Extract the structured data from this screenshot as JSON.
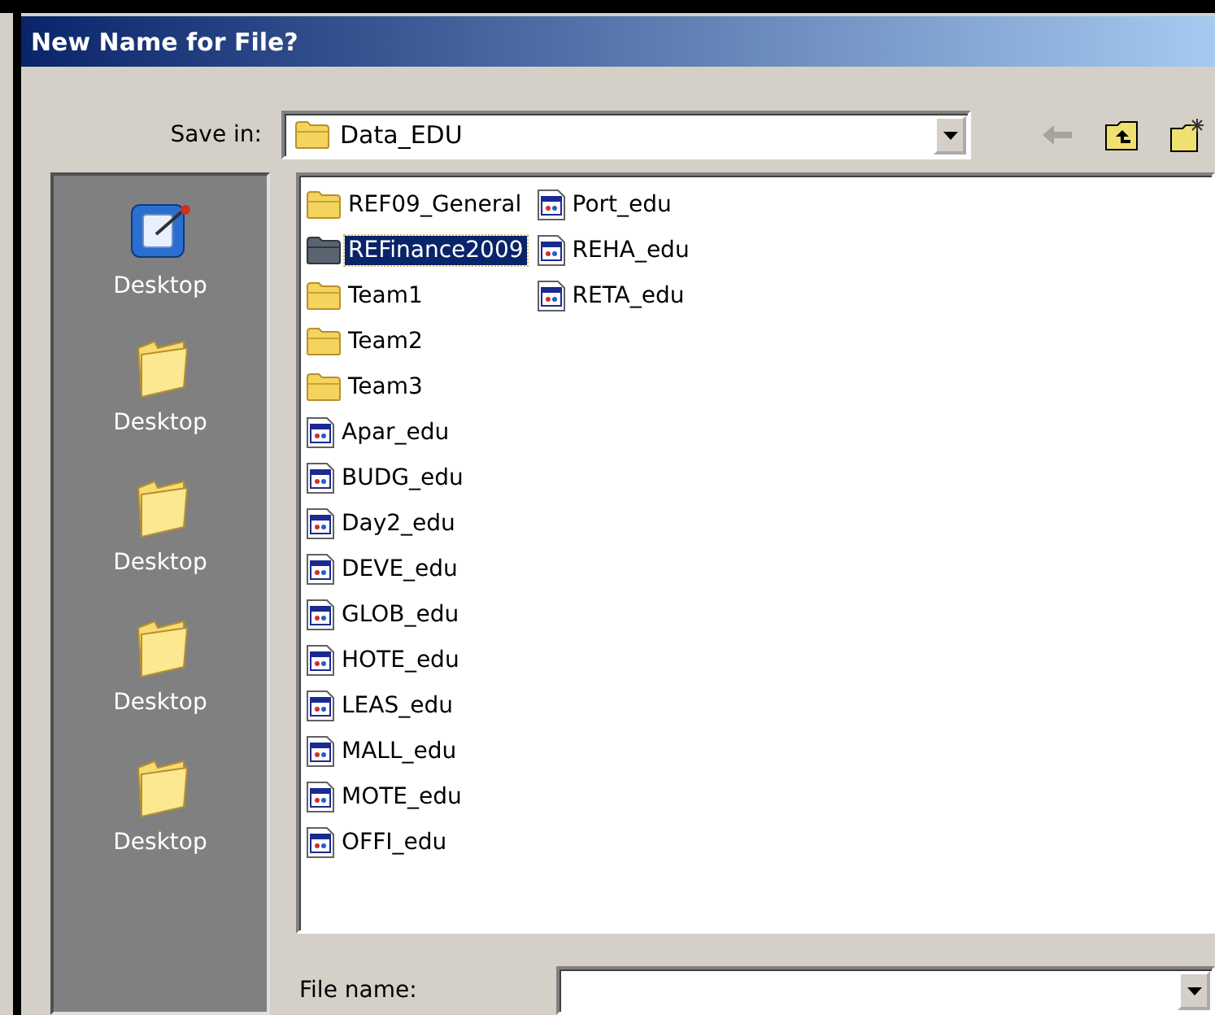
{
  "window": {
    "title": "New Name for File?"
  },
  "save_in": {
    "label": "Save in:",
    "value": "Data_EDU"
  },
  "toolbar": [
    {
      "kind": "back",
      "disabled": true
    },
    {
      "kind": "up",
      "disabled": false
    },
    {
      "kind": "newfolder",
      "disabled": false
    }
  ],
  "places": [
    {
      "kind": "desktop",
      "label": "Desktop"
    },
    {
      "kind": "folder",
      "label": "Desktop"
    },
    {
      "kind": "folder",
      "label": "Desktop"
    },
    {
      "kind": "folder",
      "label": "Desktop"
    },
    {
      "kind": "folder",
      "label": "Desktop"
    }
  ],
  "files": [
    {
      "kind": "folder",
      "name": "REF09_General",
      "selected": false
    },
    {
      "kind": "folder",
      "name": "REFinance2009",
      "selected": true
    },
    {
      "kind": "folder",
      "name": "Team1",
      "selected": false
    },
    {
      "kind": "folder",
      "name": "Team2",
      "selected": false
    },
    {
      "kind": "folder",
      "name": "Team3",
      "selected": false
    },
    {
      "kind": "file",
      "name": "Apar_edu",
      "selected": false
    },
    {
      "kind": "file",
      "name": "BUDG_edu",
      "selected": false
    },
    {
      "kind": "file",
      "name": "Day2_edu",
      "selected": false
    },
    {
      "kind": "file",
      "name": "DEVE_edu",
      "selected": false
    },
    {
      "kind": "file",
      "name": "GLOB_edu",
      "selected": false
    },
    {
      "kind": "file",
      "name": "HOTE_edu",
      "selected": false
    },
    {
      "kind": "file",
      "name": "LEAS_edu",
      "selected": false
    },
    {
      "kind": "file",
      "name": "MALL_edu",
      "selected": false
    },
    {
      "kind": "file",
      "name": "MOTE_edu",
      "selected": false
    },
    {
      "kind": "file",
      "name": "OFFI_edu",
      "selected": false
    },
    {
      "kind": "file",
      "name": "Port_edu",
      "selected": false
    },
    {
      "kind": "file",
      "name": "REHA_edu",
      "selected": false
    },
    {
      "kind": "file",
      "name": "RETA_edu",
      "selected": false
    }
  ],
  "file_name": {
    "label": "File name:"
  }
}
